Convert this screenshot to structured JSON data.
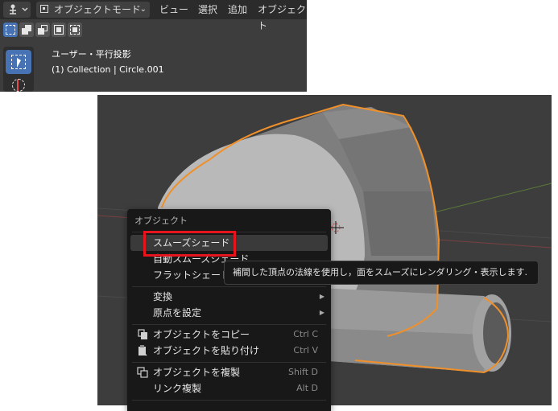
{
  "header": {
    "editor_type_icon": "viewport-gizmo-icon",
    "mode_label": "オブジェクトモード",
    "menus": [
      "ビュー",
      "選択",
      "追加",
      "オブジェクト"
    ]
  },
  "select_modes": [
    "new",
    "extend",
    "subtract",
    "invert",
    "intersect"
  ],
  "toolbar": {
    "select_tool": "select-box-icon",
    "cursor_tool": "cursor-icon"
  },
  "viewport_info": {
    "view_name": "ユーザー・平行投影",
    "collection": "(1) Collection | Circle.001"
  },
  "context_menu": {
    "title": "オブジェクト",
    "items": [
      {
        "label": "スムーズシェード",
        "shortcut": "",
        "submenu": false,
        "icon": ""
      },
      {
        "label": "自動スムーズシェード",
        "shortcut": "",
        "submenu": false,
        "icon": ""
      },
      {
        "label": "フラットシェード",
        "shortcut": "",
        "submenu": false,
        "icon": ""
      },
      {
        "label": "変換",
        "shortcut": "",
        "submenu": true,
        "icon": ""
      },
      {
        "label": "原点を設定",
        "shortcut": "",
        "submenu": true,
        "icon": ""
      },
      {
        "label": "オブジェクトをコピー",
        "shortcut": "Ctrl C",
        "submenu": false,
        "icon": "copy-icon"
      },
      {
        "label": "オブジェクトを貼り付け",
        "shortcut": "Ctrl V",
        "submenu": false,
        "icon": "paste-icon"
      },
      {
        "label": "オブジェクトを複製",
        "shortcut": "Shift D",
        "submenu": false,
        "icon": "duplicate-icon"
      },
      {
        "label": "リンク複製",
        "shortcut": "Alt D",
        "submenu": false,
        "icon": ""
      }
    ]
  },
  "tooltip": "補間した頂点の法線を使用し，面をスムーズにレンダリング・表示します.",
  "colors": {
    "highlight": "#e6151d",
    "selection_outline": "#f0902a",
    "active": "#4772b3"
  }
}
